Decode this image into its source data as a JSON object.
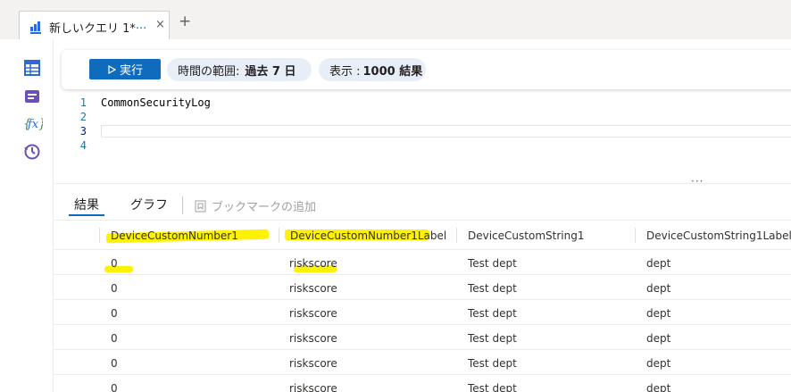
{
  "tab": {
    "title": "新しいクエリ 1*",
    "more": "···",
    "close": "×",
    "new_tab": "+"
  },
  "toolbar": {
    "run_label": "実行",
    "time_range_label": "時間の範囲:",
    "time_range_value": "過去 7 日",
    "display_label": "表示 :",
    "display_value": "1000 結果"
  },
  "editor": {
    "lines": [
      {
        "num": "1",
        "text": "CommonSecurityLog"
      },
      {
        "num": "2",
        "text": ""
      },
      {
        "num": "3",
        "text": ""
      },
      {
        "num": "4",
        "text": ""
      }
    ],
    "splitter": "···"
  },
  "results": {
    "tabs": [
      "結果",
      "グラフ"
    ],
    "active_tab": "結果",
    "bookmark_label": "ブックマークの追加",
    "columns": [
      "DeviceCustomNumber1",
      "DeviceCustomNumber1Label",
      "DeviceCustomString1",
      "DeviceCustomString1Label"
    ],
    "rows": [
      [
        "0",
        "riskscore",
        "Test dept",
        "dept"
      ],
      [
        "0",
        "riskscore",
        "Test dept",
        "dept"
      ],
      [
        "0",
        "riskscore",
        "Test dept",
        "dept"
      ],
      [
        "0",
        "riskscore",
        "Test dept",
        "dept"
      ],
      [
        "0",
        "riskscore",
        "Test dept",
        "dept"
      ],
      [
        "0",
        "riskscore",
        "Test dept",
        "dept"
      ]
    ]
  },
  "colors": {
    "accent": "#0f6cbd",
    "pill_bg": "#e8eef8",
    "highlight": "#fff200",
    "rail_icon_blue": "#2b6cd4",
    "rail_icon_purple": "#6b4fbb"
  },
  "rail": {
    "icons": [
      "table-icon",
      "saved-query-icon",
      "function-icon",
      "history-icon"
    ]
  }
}
